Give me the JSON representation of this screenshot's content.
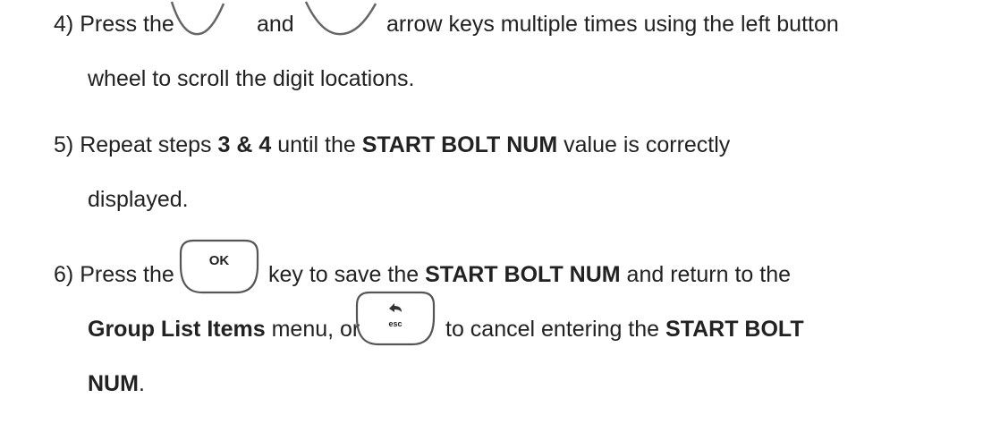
{
  "steps": [
    {
      "number": "4)",
      "parts": {
        "a": "Press the",
        "b": "and",
        "c": "arrow keys multiple times using the left button",
        "d": "wheel to scroll the digit locations."
      }
    },
    {
      "number": "5)",
      "parts": {
        "a": "Repeat steps",
        "b": "3 & 4",
        "c": "until the",
        "d": "START BOLT NUM",
        "e": "value is correctly",
        "f": "displayed."
      }
    },
    {
      "number": "6)",
      "parts": {
        "a": "Press the",
        "b": "key to save the",
        "c": "START BOLT NUM",
        "d": "and return to the",
        "e": "Group List Items",
        "f": "menu, or",
        "g": "to cancel entering the",
        "h": "START BOLT",
        "i": "NUM",
        "j": "."
      }
    }
  ],
  "keys": {
    "ok_label": "OK",
    "esc_label": "esc"
  },
  "icons": {
    "arrow_key_1": "up-arrow-key-icon",
    "arrow_key_2": "down-arrow-key-icon",
    "ok_key": "ok-key-icon",
    "esc_key": "esc-key-icon"
  },
  "colors": {
    "text": "#222222",
    "key_outline": "#666666"
  }
}
